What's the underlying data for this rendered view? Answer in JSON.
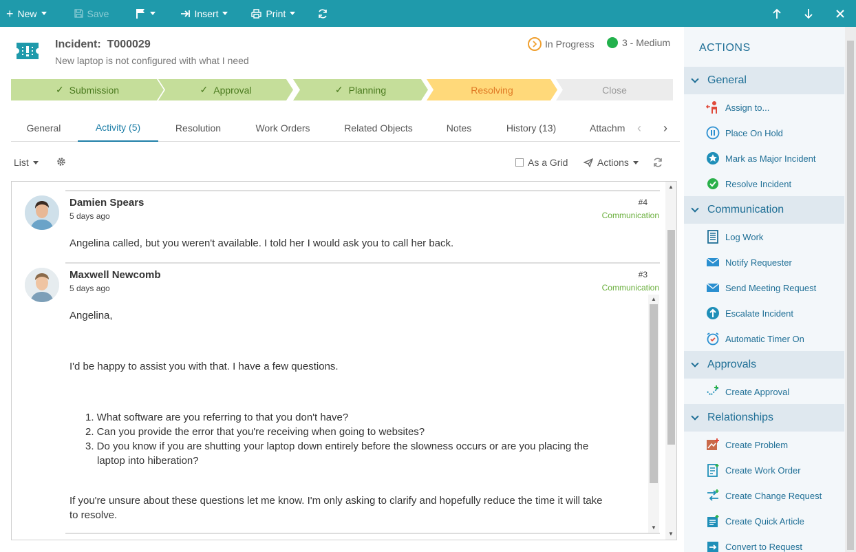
{
  "toolbar": {
    "new": "New",
    "save": "Save",
    "insert": "Insert",
    "print": "Print"
  },
  "incident": {
    "label": "Incident:",
    "id": "T000029",
    "subtitle": "New laptop is not configured with what I need",
    "status": "In Progress",
    "priority": "3 - Medium",
    "status_color": "#f0a030",
    "priority_color": "#22b14c"
  },
  "stages": [
    {
      "label": "Submission",
      "state": "done"
    },
    {
      "label": "Approval",
      "state": "done"
    },
    {
      "label": "Planning",
      "state": "done"
    },
    {
      "label": "Resolving",
      "state": "active"
    },
    {
      "label": "Close",
      "state": "future"
    }
  ],
  "tabs": [
    "General",
    "Activity (5)",
    "Resolution",
    "Work Orders",
    "Related Objects",
    "Notes",
    "History (13)",
    "Attachm"
  ],
  "subbar": {
    "view": "List",
    "as_grid": "As a Grid",
    "actions": "Actions"
  },
  "feed": [
    {
      "author": "Damien Spears",
      "time": "5 days ago",
      "num": "#4",
      "category": "Communication",
      "text": "Angelina called, but you weren't available. I told her I would ask you to call her back."
    },
    {
      "author": "Maxwell Newcomb",
      "time": "5 days ago",
      "num": "#3",
      "category": "Communication",
      "greeting": "Angelina,",
      "intro": "I'd be happy to assist you with that. I have a few questions.",
      "questions": [
        "1. What software are you referring to that you don't have?",
        "2. Can you provide the error that you're receiving when going to websites?",
        "3. Do you know if you are shutting your laptop down entirely before the slowness occurs or are you placing the",
        "laptop into hiberation?"
      ],
      "closing_1": "If you're unsure about these questions let me know. I'm only asking to clarify and hopefully reduce the time it will take",
      "closing_2": "to resolve."
    }
  ],
  "panel": {
    "title": "ACTIONS",
    "sections": [
      {
        "label": "General",
        "items": [
          "Assign to...",
          "Place On Hold",
          "Mark as Major Incident",
          "Resolve Incident"
        ]
      },
      {
        "label": "Communication",
        "items": [
          "Log Work",
          "Notify Requester",
          "Send Meeting Request",
          "Escalate Incident",
          "Automatic Timer On"
        ]
      },
      {
        "label": "Approvals",
        "items": [
          "Create Approval"
        ]
      },
      {
        "label": "Relationships",
        "items": [
          "Create Problem",
          "Create Work Order",
          "Create Change Request",
          "Create Quick Article",
          "Convert to Request"
        ]
      }
    ]
  }
}
